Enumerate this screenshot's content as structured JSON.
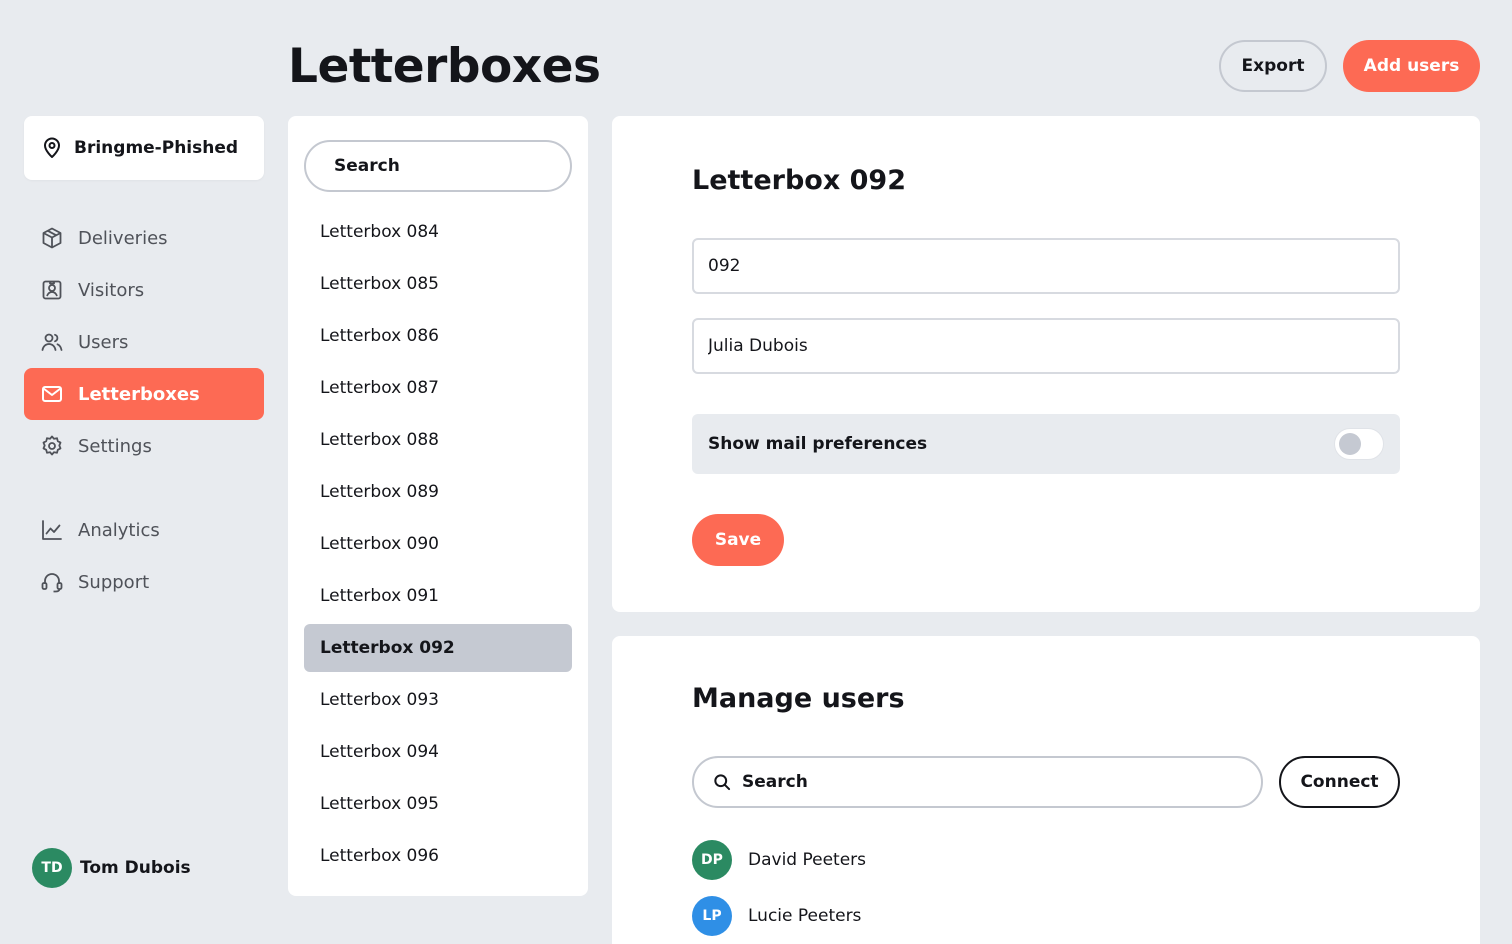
{
  "page": {
    "title": "Letterboxes"
  },
  "header": {
    "export_label": "Export",
    "add_users_label": "Add users"
  },
  "sidebar": {
    "location": "Bringme-Phished",
    "nav": [
      {
        "label": "Deliveries",
        "icon": "package-icon"
      },
      {
        "label": "Visitors",
        "icon": "visitor-badge-icon"
      },
      {
        "label": "Users",
        "icon": "users-icon"
      },
      {
        "label": "Letterboxes",
        "icon": "mail-icon",
        "active": true
      },
      {
        "label": "Settings",
        "icon": "gear-icon"
      }
    ],
    "nav_secondary": [
      {
        "label": "Analytics",
        "icon": "chart-line-icon"
      },
      {
        "label": "Support",
        "icon": "headset-icon"
      }
    ],
    "current_user": {
      "initials": "TD",
      "name": "Tom Dubois",
      "color": "#2b8a62"
    }
  },
  "letterbox_list": {
    "search_placeholder": "Search",
    "items": [
      "Letterbox 084",
      "Letterbox 085",
      "Letterbox 086",
      "Letterbox 087",
      "Letterbox 088",
      "Letterbox 089",
      "Letterbox 090",
      "Letterbox 091",
      "Letterbox 092",
      "Letterbox 093",
      "Letterbox 094",
      "Letterbox 095",
      "Letterbox 096"
    ],
    "selected_index": 8
  },
  "detail": {
    "title": "Letterbox 092",
    "number_value": "092",
    "owner_value": "Julia Dubois",
    "pref_label": "Show mail preferences",
    "pref_enabled": false,
    "save_label": "Save"
  },
  "manage_users": {
    "title": "Manage users",
    "search_placeholder": "Search",
    "connect_label": "Connect",
    "users": [
      {
        "initials": "DP",
        "name": "David Peeters",
        "color": "#2b8a62"
      },
      {
        "initials": "LP",
        "name": "Lucie Peeters",
        "color": "#2f8fe6"
      }
    ]
  },
  "colors": {
    "accent": "#fd6a54",
    "background": "#e8ebef",
    "selected": "#c5c9d2"
  }
}
